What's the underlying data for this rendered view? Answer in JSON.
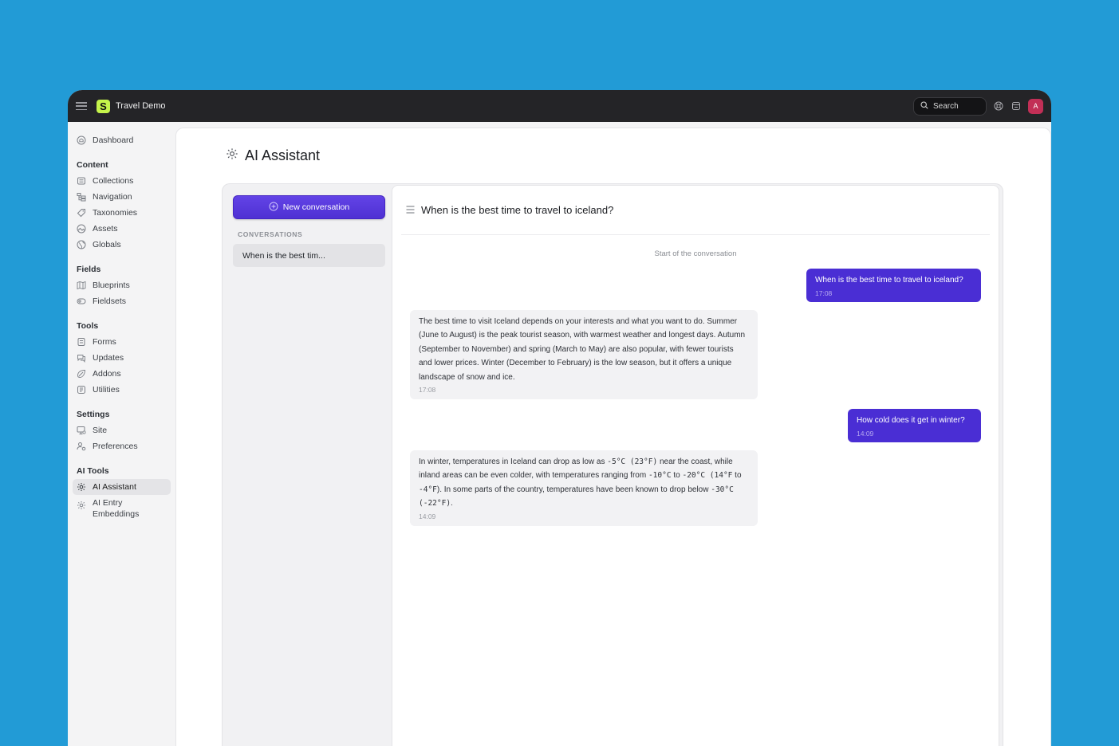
{
  "topbar": {
    "site_name": "Travel Demo",
    "logo_letter": "S",
    "search_label": "Search",
    "avatar_letter": "A",
    "avatar_color": "#c22f56"
  },
  "sidebar": {
    "dashboard": "Dashboard",
    "sections": [
      {
        "title": "Content",
        "items": [
          "Collections",
          "Navigation",
          "Taxonomies",
          "Assets",
          "Globals"
        ]
      },
      {
        "title": "Fields",
        "items": [
          "Blueprints",
          "Fieldsets"
        ]
      },
      {
        "title": "Tools",
        "items": [
          "Forms",
          "Updates",
          "Addons",
          "Utilities"
        ]
      },
      {
        "title": "Settings",
        "items": [
          "Site",
          "Preferences"
        ]
      },
      {
        "title": "AI Tools",
        "items": [
          "AI Assistant",
          "AI Entry Embeddings"
        ]
      }
    ],
    "active_item": "AI Assistant"
  },
  "page": {
    "title": "AI Assistant"
  },
  "assistant": {
    "new_conversation_label": "New conversation",
    "conversations_heading": "CONVERSATIONS",
    "conversations": [
      "When is the best tim..."
    ],
    "chat_title": "When is the best time to travel to iceland?",
    "start_note": "Start of the conversation",
    "messages": [
      {
        "role": "user",
        "text": "When is the best time to travel to iceland?",
        "time": "17:08"
      },
      {
        "role": "assistant",
        "text": "The best time to visit Iceland depends on your interests and what you want to do. Summer (June to August) is the peak tourist season, with warmest weather and longest days. Autumn (September to November) and spring (March to May) are also popular, with fewer tourists and lower prices. Winter (December to February) is the low season, but it offers a unique landscape of snow and ice.",
        "time": "17:08"
      },
      {
        "role": "user",
        "text": "How cold does it get in winter?",
        "time": "14:09"
      },
      {
        "role": "assistant",
        "time": "14:09",
        "parts": {
          "p1": "In winter, temperatures in Iceland can drop as low as ",
          "v1": "-5°C (23°F)",
          "p2": " near the coast, while inland areas can be even colder, with temperatures ranging from ",
          "v2": "-10°C",
          "p3": " to ",
          "v3": "-20°C (14°F",
          "p4": " to ",
          "v4": "-4°F",
          "p5": "). In some parts of the country, temperatures have been known to drop below ",
          "v5": "-30°C (-22°F)",
          "p6": "."
        }
      }
    ],
    "accent_color": "#4a2ed4"
  }
}
